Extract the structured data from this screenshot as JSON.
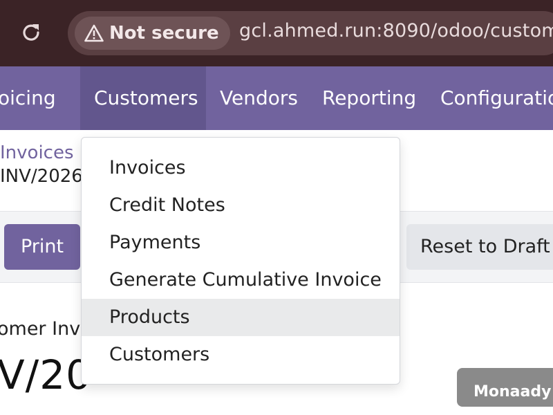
{
  "browser": {
    "reload_icon": "reload-icon",
    "security_icon": "warning-triangle-icon",
    "security_label": "Not secure",
    "url": "gcl.ahmed.run:8090/odoo/custome"
  },
  "topnav": {
    "items": [
      {
        "label": "oicing"
      },
      {
        "label": "Customers",
        "active": true
      },
      {
        "label": "Vendors"
      },
      {
        "label": "Reporting"
      },
      {
        "label": "Configuratio"
      }
    ],
    "color": "#71639e"
  },
  "breadcrumb": {
    "parent": "Invoices",
    "current": "INV/2026"
  },
  "controls": {
    "print_label": "Print",
    "reset_label": "Reset to Draft"
  },
  "document": {
    "subtitle": "omer Inv",
    "number": "V/20",
    "user_badge": "Monaady"
  },
  "dropdown": {
    "items": [
      {
        "label": "Invoices"
      },
      {
        "label": "Credit Notes"
      },
      {
        "label": "Payments"
      },
      {
        "label": "Generate Cumulative Invoice"
      },
      {
        "label": "Products",
        "hovered": true
      },
      {
        "label": "Customers"
      }
    ]
  }
}
